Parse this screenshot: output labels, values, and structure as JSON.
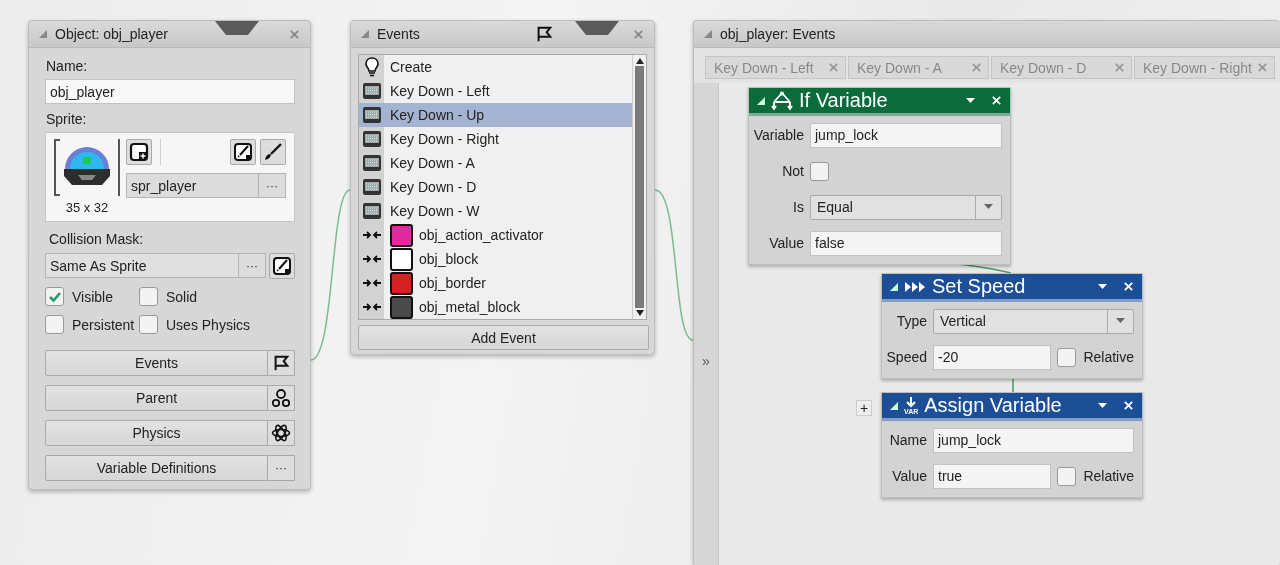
{
  "object_window": {
    "title": "Object: obj_player",
    "name_label": "Name:",
    "name": "obj_player",
    "sprite_label": "Sprite:",
    "sprite_size": "35 x 32",
    "sprite_name": "spr_player",
    "sprite_more": "···",
    "mask_label": "Collision Mask:",
    "mask": "Same As Sprite",
    "mask_more": "···",
    "checkboxes": [
      {
        "label": "Visible",
        "checked": true
      },
      {
        "label": "Solid",
        "checked": false
      },
      {
        "label": "Persistent",
        "checked": false
      },
      {
        "label": "Uses Physics",
        "checked": false
      }
    ],
    "buttons": [
      {
        "label": "Events",
        "kind": "flag"
      },
      {
        "label": "Parent",
        "kind": "parent"
      },
      {
        "label": "Physics",
        "kind": "physics"
      },
      {
        "label": "Variable Definitions",
        "kind": "more",
        "side_text": "···"
      }
    ]
  },
  "events_window": {
    "title": "Events",
    "events": [
      {
        "label": "Create",
        "kind": "create",
        "selected": false
      },
      {
        "label": "Key Down - Left",
        "kind": "key",
        "selected": false
      },
      {
        "label": "Key Down - Up",
        "kind": "key",
        "selected": true
      },
      {
        "label": "Key Down - Right",
        "kind": "key",
        "selected": false
      },
      {
        "label": "Key Down - A",
        "kind": "key",
        "selected": false
      },
      {
        "label": "Key Down - D",
        "kind": "key",
        "selected": false
      },
      {
        "label": "Key Down - W",
        "kind": "key",
        "selected": false
      },
      {
        "label": "obj_action_activator",
        "kind": "collision",
        "color": "#e22aa0",
        "selected": false
      },
      {
        "label": "obj_block",
        "kind": "collision",
        "color": "#ffffff",
        "selected": false
      },
      {
        "label": "obj_border",
        "kind": "collision",
        "color": "#d42222",
        "selected": false
      },
      {
        "label": "obj_metal_block",
        "kind": "collision",
        "color": "#4a4a4a",
        "selected": false
      }
    ],
    "add_button": "Add Event"
  },
  "editor": {
    "title": "obj_player: Events",
    "tabs": [
      {
        "label": "Key Down - Left",
        "selected": false
      },
      {
        "label": "Key Down - A",
        "selected": false
      },
      {
        "label": "Key Down - D",
        "selected": false
      },
      {
        "label": "Key Down - Right",
        "selected": false
      }
    ],
    "gutter_glyph": "»",
    "add_glyph": "+",
    "actions": [
      {
        "kind": "if",
        "title": "If Variable",
        "color": "#0b6b3a",
        "fields": [
          {
            "kind": "text",
            "label": "Variable",
            "value": "jump_lock"
          },
          {
            "kind": "checkbox",
            "label": "Not",
            "checked": false
          },
          {
            "kind": "select",
            "label": "Is",
            "value": "Equal"
          },
          {
            "kind": "text",
            "label": "Value",
            "value": "false"
          }
        ]
      },
      {
        "kind": "speed",
        "title": "Set Speed",
        "color": "#1d4f96",
        "fields": [
          {
            "kind": "select",
            "label": "Type",
            "value": "Vertical"
          },
          {
            "kind": "relative",
            "label": "Speed",
            "value": "-20",
            "option": "Relative",
            "checked": false
          }
        ]
      },
      {
        "kind": "assign",
        "title": "Assign Variable",
        "icon_text": "VAR",
        "color": "#1d4f96",
        "fields": [
          {
            "kind": "text",
            "label": "Name",
            "value": "jump_lock"
          },
          {
            "kind": "relative",
            "label": "Value",
            "value": "true",
            "option": "Relative",
            "checked": false
          }
        ]
      }
    ]
  }
}
